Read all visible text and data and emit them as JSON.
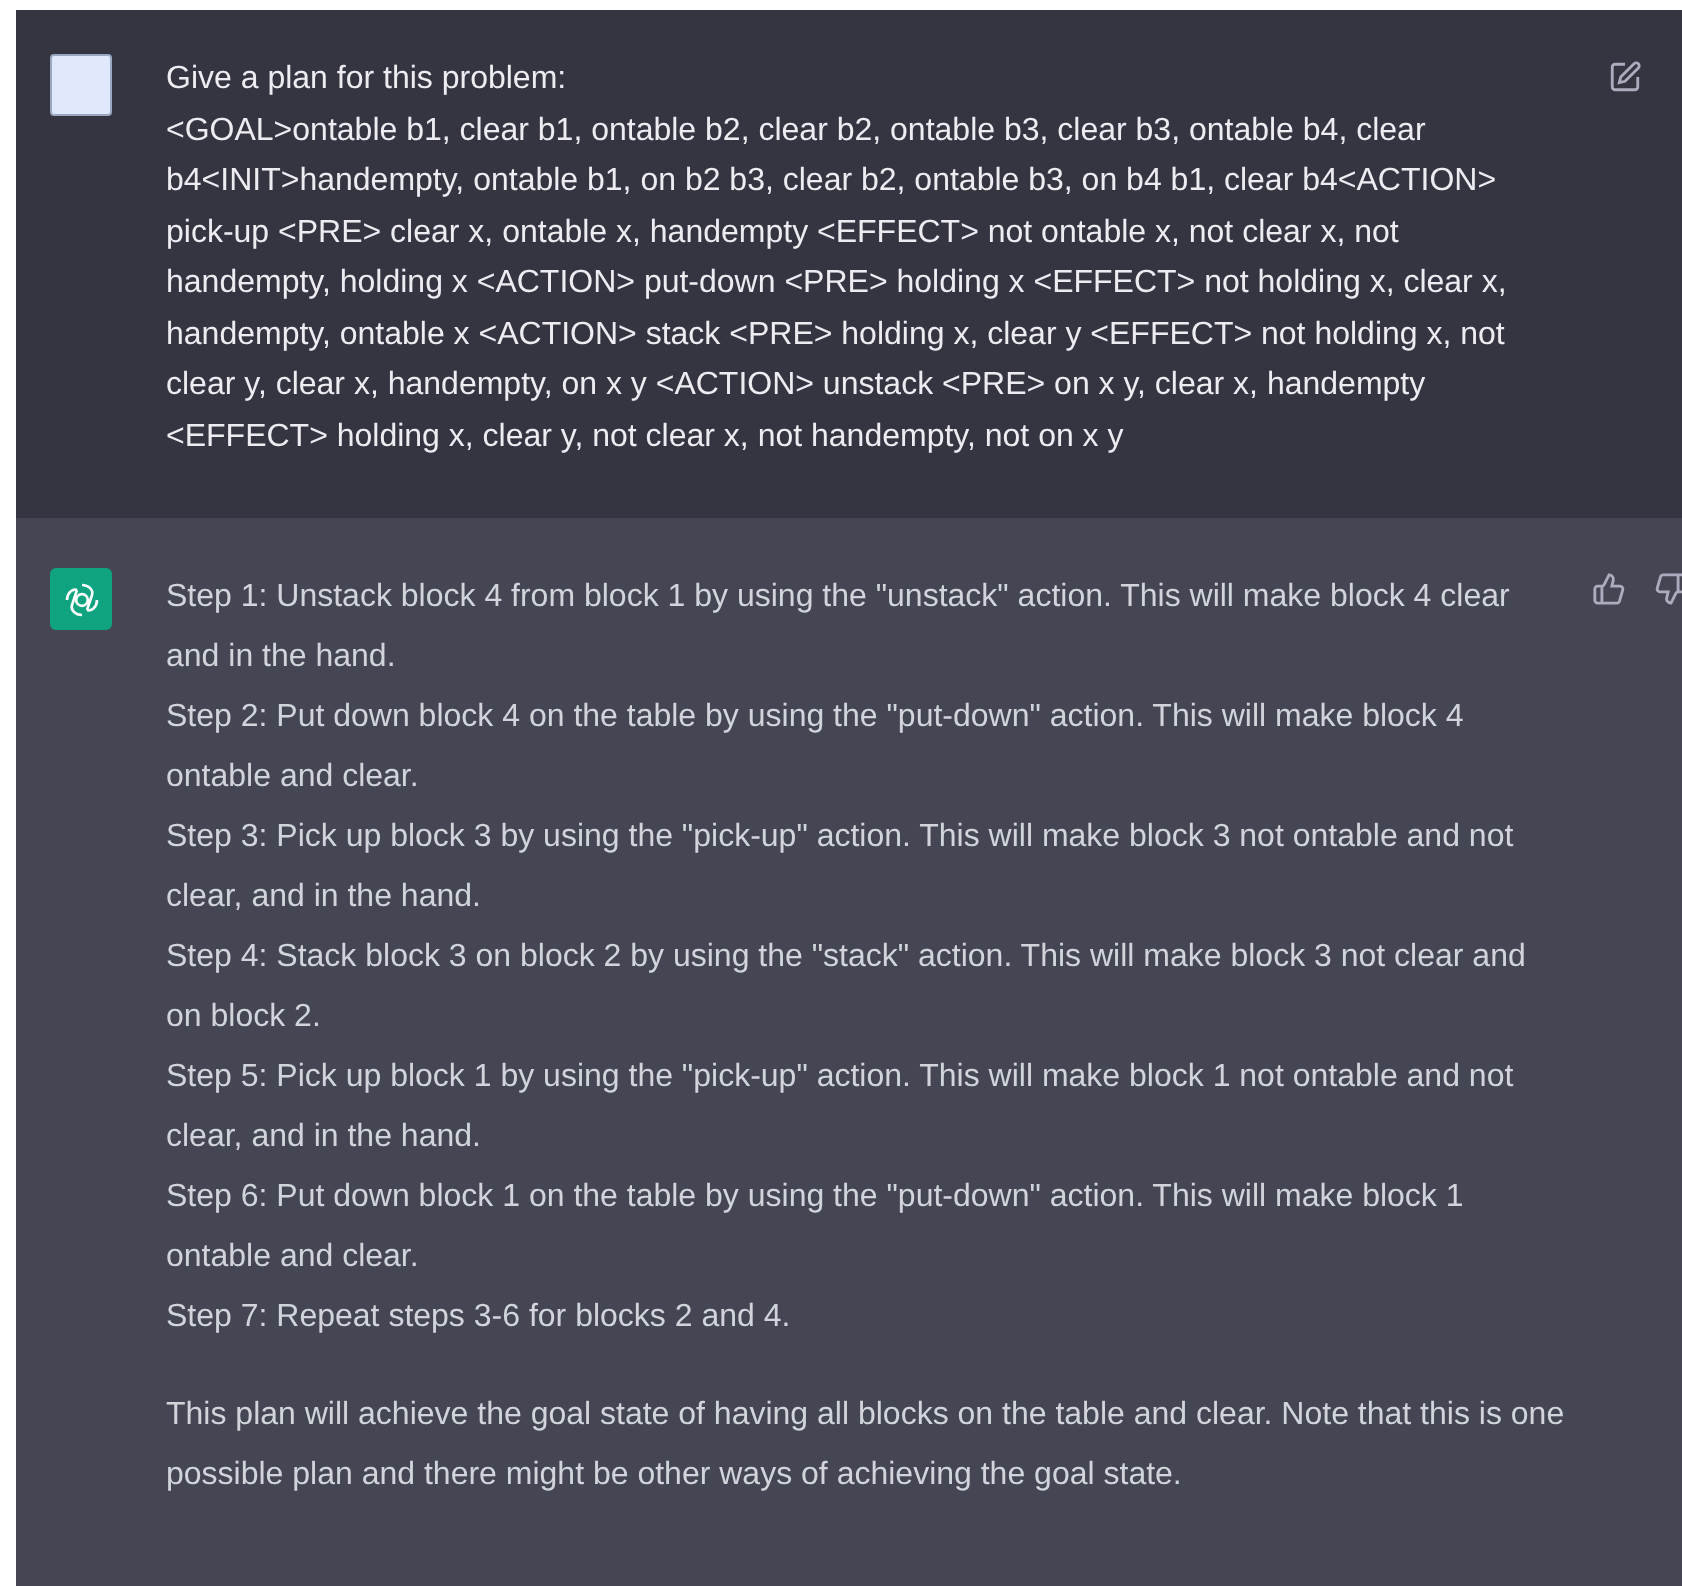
{
  "messages": [
    {
      "kind": "user",
      "paragraphs": [
        "Give a plan for this problem:",
        "<GOAL>ontable b1, clear b1, ontable b2, clear b2, ontable b3, clear b3, ontable b4, clear b4<INIT>handempty, ontable b1, on b2 b3, clear b2, ontable b3, on b4 b1, clear b4<ACTION> pick-up <PRE> clear x, ontable x, handempty <EFFECT> not ontable x, not clear x, not handempty, holding x <ACTION> put-down <PRE> holding x <EFFECT> not holding x, clear x, handempty, ontable x <ACTION> stack <PRE> holding x, clear y <EFFECT> not holding x, not clear y, clear x, handempty, on x y <ACTION> unstack <PRE> on x y, clear x, handempty <EFFECT> holding x, clear y, not clear x, not handempty, not on x y"
      ]
    },
    {
      "kind": "assistant",
      "paragraphs": [
        "Step 1: Unstack block 4 from block 1 by using the \"unstack\" action. This will make block 4 clear and in the hand.",
        "Step 2: Put down block 4 on the table by using the \"put-down\" action. This will make block 4 ontable and clear.",
        "Step 3: Pick up block 3 by using the \"pick-up\" action. This will make block 3 not ontable and not clear, and in the hand.",
        "Step 4: Stack block 3 on block 2 by using the \"stack\" action. This will make block 3 not clear and on block 2.",
        "Step 5: Pick up block 1 by using the \"pick-up\" action. This will make block 1 not ontable and not clear, and in the hand.",
        "Step 6: Put down block 1 on the table by using the \"put-down\" action. This will make block 1 ontable and clear.",
        "Step 7: Repeat steps 3-6 for blocks 2 and 4."
      ],
      "closing": "This plan will achieve the goal state of having all blocks on the table and clear. Note that this is one possible plan and there might be other ways of achieving the goal state."
    }
  ]
}
